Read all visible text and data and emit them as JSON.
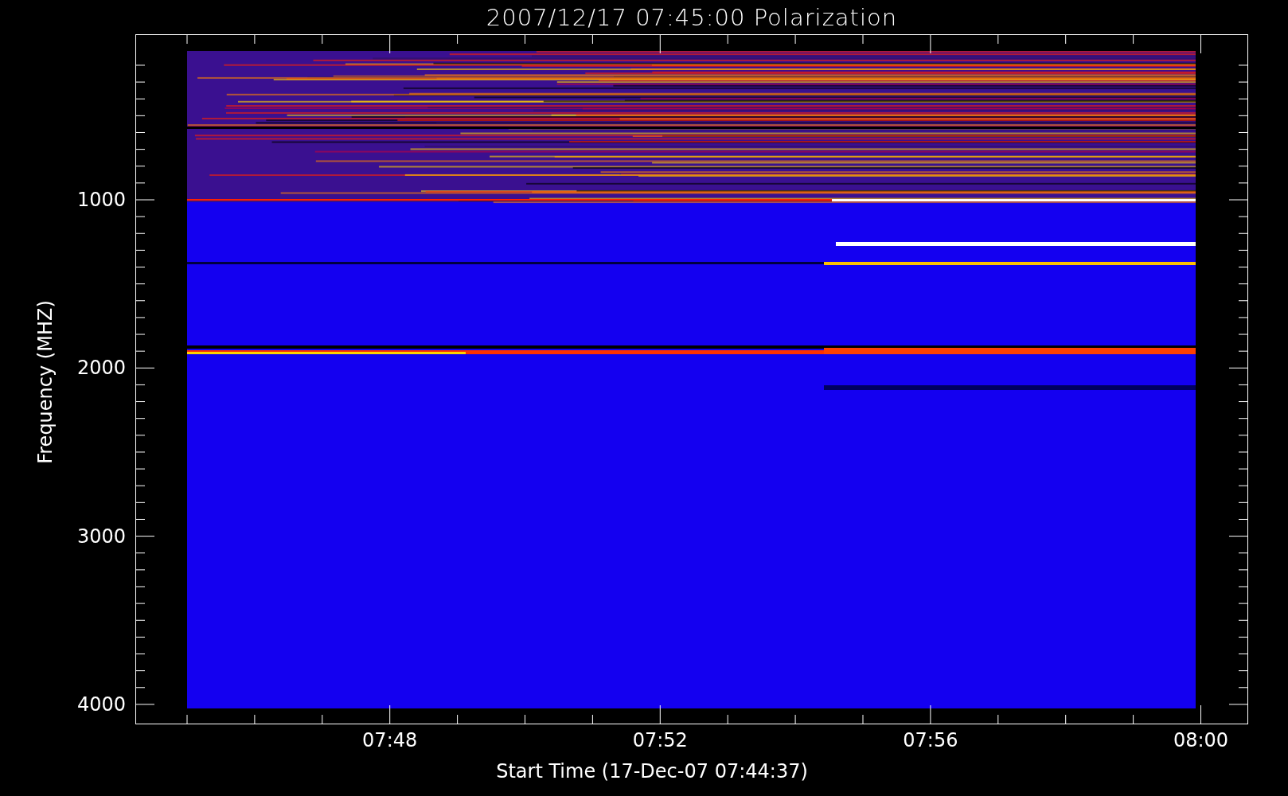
{
  "title": "2007/12/17 07:45:00 Polarization",
  "y_axis": {
    "label": "Frequency (MHZ)",
    "ticks": [
      "1000",
      "2000",
      "3000",
      "4000"
    ]
  },
  "x_axis": {
    "label": "Start Time (17-Dec-07 07:44:37)",
    "ticks": [
      "07:48",
      "07:52",
      "07:56",
      "08:00"
    ]
  }
}
